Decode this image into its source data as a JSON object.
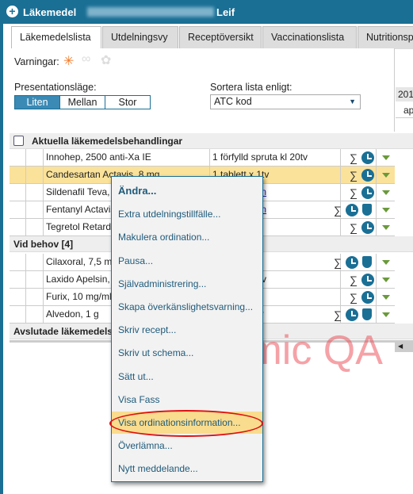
{
  "window": {
    "title": "Läkemedel",
    "patient_name": "Leif"
  },
  "tabs": [
    "Läkemedelslista",
    "Utdelningsvy",
    "Receptöversikt",
    "Vaccinationslista",
    "Nutritionspr"
  ],
  "warnings": {
    "label": "Varningar:"
  },
  "presentation": {
    "label": "Presentationsläge:",
    "options": [
      "Liten",
      "Mellan",
      "Stor"
    ],
    "selected": "Liten"
  },
  "sort": {
    "label": "Sortera lista enligt:",
    "value": "ATC kod"
  },
  "right_panel": {
    "year": "201",
    "month": "ap"
  },
  "groups": {
    "current": {
      "title": "Aktuella läkemedelsbehandlingar",
      "rows": [
        {
          "name": "Innohep, 2500 anti-Xa IE",
          "dose": "1 förfylld spruta kl 20tv",
          "bag": false
        },
        {
          "name": "Candesartan Actavis, 8 mg",
          "dose": "1 tablett x 1tv",
          "bag": false
        },
        {
          "name": "Sildenafil Teva,",
          "dose": "ild ordination",
          "link": true,
          "bag": false
        },
        {
          "name": "Fentanyl Actavis",
          "dose": "ild ordination",
          "link": true,
          "bag": true
        },
        {
          "name": "Tegretol Retard",
          "dose": "v",
          "bag": false
        }
      ]
    },
    "prn": {
      "title": "Vid behov [4]",
      "rows": [
        {
          "name": "Cilaxoral, 7,5 m",
          "dose": "ar  vbtv",
          "bag": true
        },
        {
          "name": "Laxido Apelsin,",
          "dose": "vb max3/d tv",
          "bag": false
        },
        {
          "name": "Furix, 10 mg/ml",
          "dose": "",
          "bag": false
        },
        {
          "name": "Alvedon, 1 g",
          "dose": "rium x 4vbtv",
          "bag": true
        }
      ]
    },
    "ended": {
      "title": "Avslutade läkemedels"
    }
  },
  "context_menu": {
    "items": [
      "Ändra...",
      "Extra utdelningstillfälle...",
      "Makulera ordination...",
      "Pausa...",
      "Självadministrering...",
      "Skapa överkänslighetsvarning...",
      "Skriv recept...",
      "Skriv ut schema...",
      "Sätt ut...",
      "Visa Fass",
      "Visa ordinationsinformation...",
      "Överlämna...",
      "Nytt meddelande..."
    ],
    "highlighted": "Visa ordinationsinformation..."
  },
  "watermark": "Cosmic QA",
  "colors": {
    "titlebar": "#1a6f95",
    "selected_row": "#fbe29a",
    "annotation": "#dd1111"
  }
}
